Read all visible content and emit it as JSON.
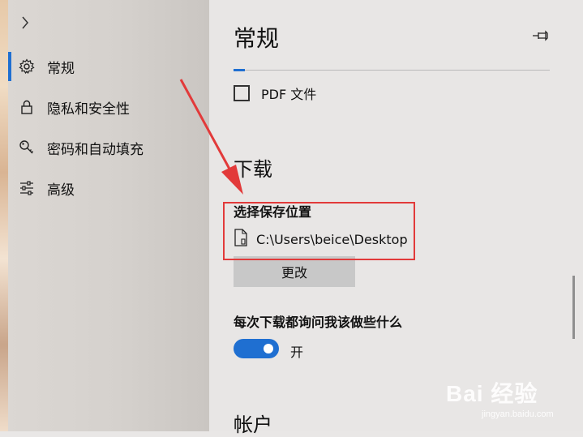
{
  "sidebar": {
    "expand_icon": "chevron-right-icon",
    "items": [
      {
        "label": "常规",
        "icon": "gear-icon",
        "active": true
      },
      {
        "label": "隐私和安全性",
        "icon": "lock-icon",
        "active": false
      },
      {
        "label": "密码和自动填充",
        "icon": "key-icon",
        "active": false
      },
      {
        "label": "高级",
        "icon": "sliders-icon",
        "active": false
      }
    ]
  },
  "main": {
    "title": "常规",
    "pin_icon": "pin-icon",
    "pdf_checkbox": {
      "label": "PDF 文件",
      "checked": false
    },
    "downloads": {
      "title": "下载",
      "location_label": "选择保存位置",
      "path": "C:\\Users\\beice\\Desktop",
      "change_button": "更改",
      "ask_label": "每次下载都询问我该做些什么",
      "toggle_state": "开",
      "toggle_on": true
    },
    "account_title": "帐户"
  },
  "watermark": {
    "main": "Bai 经验",
    "sub": "jingyan.baidu.com"
  },
  "colors": {
    "accent": "#1f6fd1",
    "annotation": "#e23a3a"
  }
}
